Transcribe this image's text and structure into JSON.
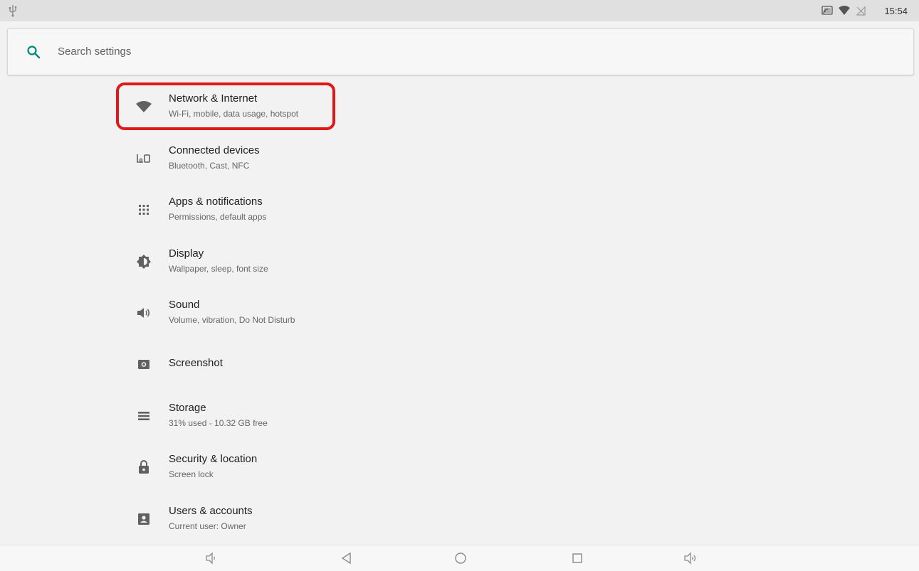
{
  "status_bar": {
    "time": "15:54",
    "icons": [
      "usb-icon",
      "cast-icon",
      "wifi-icon",
      "no-sim-icon"
    ]
  },
  "search": {
    "placeholder": "Search settings",
    "icon": "search-icon",
    "accent_color": "#00897b"
  },
  "settings": [
    {
      "title": "Network & Internet",
      "subtitle": "Wi-Fi, mobile, data usage, hotspot",
      "icon": "wifi-icon"
    },
    {
      "title": "Connected devices",
      "subtitle": "Bluetooth, Cast, NFC",
      "icon": "devices-icon"
    },
    {
      "title": "Apps & notifications",
      "subtitle": "Permissions, default apps",
      "icon": "apps-grid-icon"
    },
    {
      "title": "Display",
      "subtitle": "Wallpaper, sleep, font size",
      "icon": "brightness-icon"
    },
    {
      "title": "Sound",
      "subtitle": "Volume, vibration, Do Not Disturb",
      "icon": "volume-icon"
    },
    {
      "title": "Screenshot",
      "subtitle": "",
      "icon": "camera-icon"
    },
    {
      "title": "Storage",
      "subtitle": "31% used - 10.32 GB free",
      "icon": "storage-icon"
    },
    {
      "title": "Security & location",
      "subtitle": "Screen lock",
      "icon": "lock-icon"
    },
    {
      "title": "Users & accounts",
      "subtitle": "Current user: Owner",
      "icon": "account-box-icon"
    }
  ],
  "highlight": {
    "target": "Network & Internet",
    "color": "#e01818"
  },
  "nav_bar": {
    "buttons": [
      "volume-down-icon",
      "back-icon",
      "home-icon",
      "recents-icon",
      "volume-up-icon"
    ]
  }
}
